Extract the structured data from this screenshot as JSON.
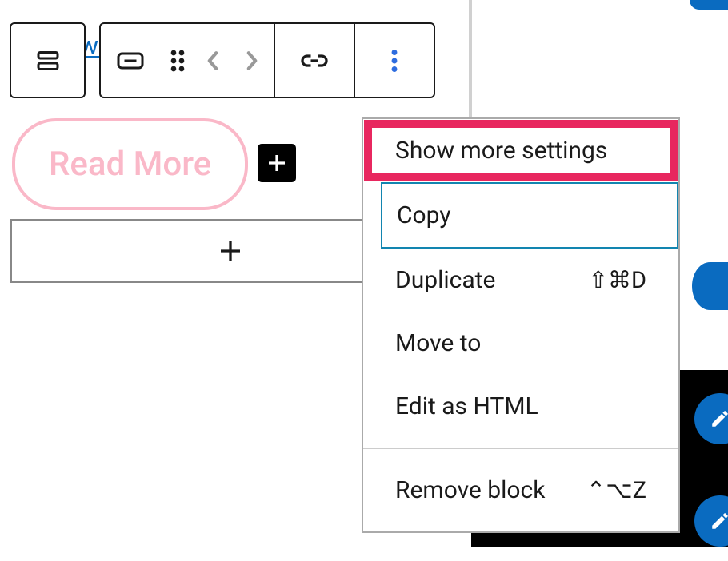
{
  "background_link_text": "wo",
  "readmore_label": "Read More",
  "dropdown": {
    "items": [
      {
        "label": "Show more settings",
        "shortcut": ""
      },
      {
        "label": "Copy",
        "shortcut": ""
      },
      {
        "label": "Duplicate",
        "shortcut": "⇧⌘D"
      },
      {
        "label": "Move to",
        "shortcut": ""
      },
      {
        "label": "Edit as HTML",
        "shortcut": ""
      },
      {
        "label": "Remove block",
        "shortcut": "⌃⌥Z"
      }
    ]
  },
  "icons": {
    "block_parent": "block-parent",
    "button_type": "button-type",
    "drag": "drag",
    "prev": "prev",
    "next": "next",
    "link": "link",
    "more": "more",
    "plus": "plus",
    "pencil": "pencil"
  }
}
